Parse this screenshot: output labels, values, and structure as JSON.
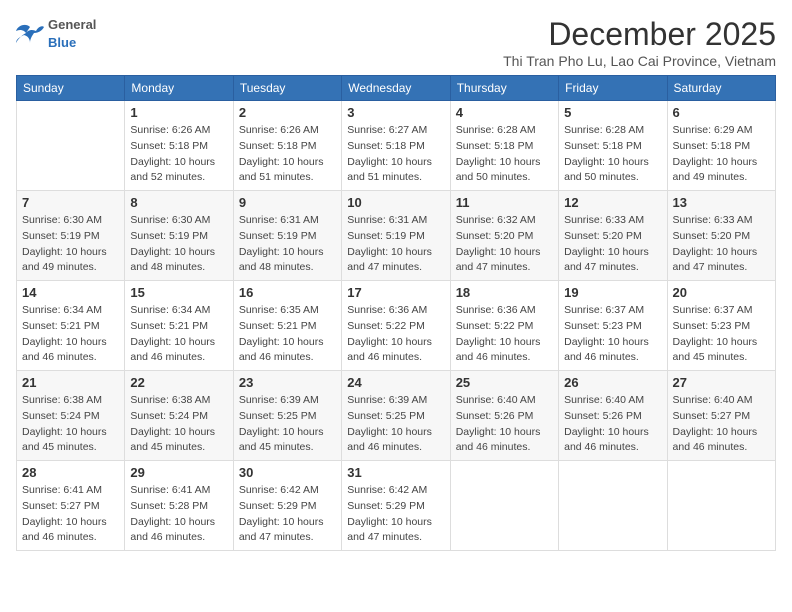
{
  "header": {
    "logo": {
      "general": "General",
      "blue": "Blue"
    },
    "title": "December 2025",
    "subtitle": "Thi Tran Pho Lu, Lao Cai Province, Vietnam"
  },
  "calendar": {
    "weekdays": [
      "Sunday",
      "Monday",
      "Tuesday",
      "Wednesday",
      "Thursday",
      "Friday",
      "Saturday"
    ],
    "weeks": [
      [
        {
          "day": "",
          "info": ""
        },
        {
          "day": "1",
          "info": "Sunrise: 6:26 AM\nSunset: 5:18 PM\nDaylight: 10 hours\nand 52 minutes."
        },
        {
          "day": "2",
          "info": "Sunrise: 6:26 AM\nSunset: 5:18 PM\nDaylight: 10 hours\nand 51 minutes."
        },
        {
          "day": "3",
          "info": "Sunrise: 6:27 AM\nSunset: 5:18 PM\nDaylight: 10 hours\nand 51 minutes."
        },
        {
          "day": "4",
          "info": "Sunrise: 6:28 AM\nSunset: 5:18 PM\nDaylight: 10 hours\nand 50 minutes."
        },
        {
          "day": "5",
          "info": "Sunrise: 6:28 AM\nSunset: 5:18 PM\nDaylight: 10 hours\nand 50 minutes."
        },
        {
          "day": "6",
          "info": "Sunrise: 6:29 AM\nSunset: 5:18 PM\nDaylight: 10 hours\nand 49 minutes."
        }
      ],
      [
        {
          "day": "7",
          "info": "Sunrise: 6:30 AM\nSunset: 5:19 PM\nDaylight: 10 hours\nand 49 minutes."
        },
        {
          "day": "8",
          "info": "Sunrise: 6:30 AM\nSunset: 5:19 PM\nDaylight: 10 hours\nand 48 minutes."
        },
        {
          "day": "9",
          "info": "Sunrise: 6:31 AM\nSunset: 5:19 PM\nDaylight: 10 hours\nand 48 minutes."
        },
        {
          "day": "10",
          "info": "Sunrise: 6:31 AM\nSunset: 5:19 PM\nDaylight: 10 hours\nand 47 minutes."
        },
        {
          "day": "11",
          "info": "Sunrise: 6:32 AM\nSunset: 5:20 PM\nDaylight: 10 hours\nand 47 minutes."
        },
        {
          "day": "12",
          "info": "Sunrise: 6:33 AM\nSunset: 5:20 PM\nDaylight: 10 hours\nand 47 minutes."
        },
        {
          "day": "13",
          "info": "Sunrise: 6:33 AM\nSunset: 5:20 PM\nDaylight: 10 hours\nand 47 minutes."
        }
      ],
      [
        {
          "day": "14",
          "info": "Sunrise: 6:34 AM\nSunset: 5:21 PM\nDaylight: 10 hours\nand 46 minutes."
        },
        {
          "day": "15",
          "info": "Sunrise: 6:34 AM\nSunset: 5:21 PM\nDaylight: 10 hours\nand 46 minutes."
        },
        {
          "day": "16",
          "info": "Sunrise: 6:35 AM\nSunset: 5:21 PM\nDaylight: 10 hours\nand 46 minutes."
        },
        {
          "day": "17",
          "info": "Sunrise: 6:36 AM\nSunset: 5:22 PM\nDaylight: 10 hours\nand 46 minutes."
        },
        {
          "day": "18",
          "info": "Sunrise: 6:36 AM\nSunset: 5:22 PM\nDaylight: 10 hours\nand 46 minutes."
        },
        {
          "day": "19",
          "info": "Sunrise: 6:37 AM\nSunset: 5:23 PM\nDaylight: 10 hours\nand 46 minutes."
        },
        {
          "day": "20",
          "info": "Sunrise: 6:37 AM\nSunset: 5:23 PM\nDaylight: 10 hours\nand 45 minutes."
        }
      ],
      [
        {
          "day": "21",
          "info": "Sunrise: 6:38 AM\nSunset: 5:24 PM\nDaylight: 10 hours\nand 45 minutes."
        },
        {
          "day": "22",
          "info": "Sunrise: 6:38 AM\nSunset: 5:24 PM\nDaylight: 10 hours\nand 45 minutes."
        },
        {
          "day": "23",
          "info": "Sunrise: 6:39 AM\nSunset: 5:25 PM\nDaylight: 10 hours\nand 45 minutes."
        },
        {
          "day": "24",
          "info": "Sunrise: 6:39 AM\nSunset: 5:25 PM\nDaylight: 10 hours\nand 46 minutes."
        },
        {
          "day": "25",
          "info": "Sunrise: 6:40 AM\nSunset: 5:26 PM\nDaylight: 10 hours\nand 46 minutes."
        },
        {
          "day": "26",
          "info": "Sunrise: 6:40 AM\nSunset: 5:26 PM\nDaylight: 10 hours\nand 46 minutes."
        },
        {
          "day": "27",
          "info": "Sunrise: 6:40 AM\nSunset: 5:27 PM\nDaylight: 10 hours\nand 46 minutes."
        }
      ],
      [
        {
          "day": "28",
          "info": "Sunrise: 6:41 AM\nSunset: 5:27 PM\nDaylight: 10 hours\nand 46 minutes."
        },
        {
          "day": "29",
          "info": "Sunrise: 6:41 AM\nSunset: 5:28 PM\nDaylight: 10 hours\nand 46 minutes."
        },
        {
          "day": "30",
          "info": "Sunrise: 6:42 AM\nSunset: 5:29 PM\nDaylight: 10 hours\nand 47 minutes."
        },
        {
          "day": "31",
          "info": "Sunrise: 6:42 AM\nSunset: 5:29 PM\nDaylight: 10 hours\nand 47 minutes."
        },
        {
          "day": "",
          "info": ""
        },
        {
          "day": "",
          "info": ""
        },
        {
          "day": "",
          "info": ""
        }
      ]
    ]
  }
}
